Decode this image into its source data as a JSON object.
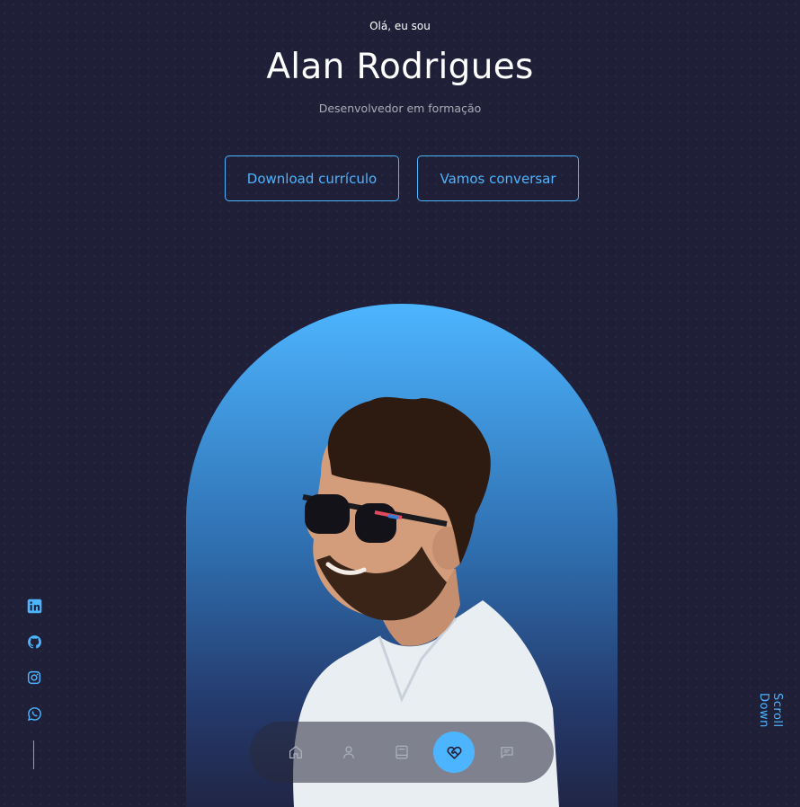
{
  "header": {
    "greeting": "Olá, eu sou",
    "name": "Alan Rodrigues",
    "role": "Desenvolvedor em formação"
  },
  "cta": {
    "download_label": "Download currículo",
    "talk_label": "Vamos conversar"
  },
  "socials": [
    {
      "icon": "linkedin-icon"
    },
    {
      "icon": "github-icon"
    },
    {
      "icon": "instagram-icon"
    },
    {
      "icon": "whatsapp-icon"
    }
  ],
  "scroll": {
    "label": "Scroll Down"
  },
  "nav": {
    "items": [
      {
        "icon": "home-icon",
        "active": false
      },
      {
        "icon": "user-icon",
        "active": false
      },
      {
        "icon": "book-icon",
        "active": false
      },
      {
        "icon": "heart-handshake-icon",
        "active": true
      },
      {
        "icon": "message-icon",
        "active": false
      }
    ]
  },
  "colors": {
    "background": "#1f1f38",
    "accent": "#4db5ff",
    "text": "#ffffff"
  }
}
